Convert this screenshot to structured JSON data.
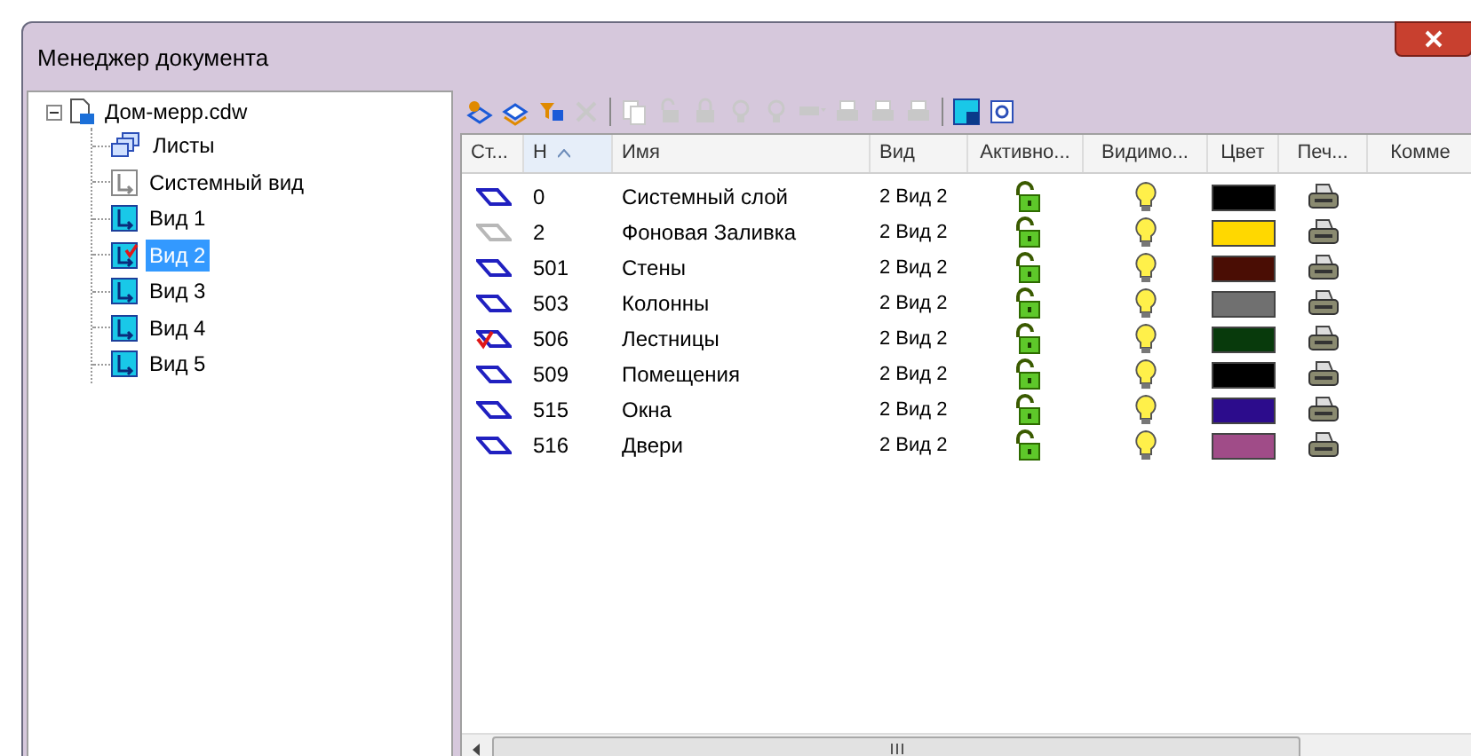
{
  "window": {
    "title": "Менеджер документа"
  },
  "tree": {
    "label": "Дом-мерр.cdw",
    "kind": "file",
    "expanded": true,
    "children": [
      {
        "label": "Листы",
        "kind": "sheets",
        "selected": false,
        "current": false
      },
      {
        "label": "Системный вид",
        "kind": "system-view",
        "selected": false,
        "current": false
      },
      {
        "label": "Вид 1",
        "kind": "view",
        "selected": false,
        "current": false
      },
      {
        "label": "Вид 2",
        "kind": "view",
        "selected": true,
        "current": true
      },
      {
        "label": "Вид 3",
        "kind": "view",
        "selected": false,
        "current": false
      },
      {
        "label": "Вид 4",
        "kind": "view",
        "selected": false,
        "current": false
      },
      {
        "label": "Вид 5",
        "kind": "view",
        "selected": false,
        "current": false
      }
    ]
  },
  "toolbar": [
    {
      "kind": "new-layer",
      "disabled": false
    },
    {
      "kind": "layers",
      "disabled": false
    },
    {
      "kind": "filter",
      "disabled": false
    },
    {
      "kind": "delete",
      "disabled": true
    },
    {
      "kind": "sep"
    },
    {
      "kind": "copy",
      "disabled": true
    },
    {
      "kind": "lock-open",
      "disabled": true
    },
    {
      "kind": "lock",
      "disabled": true
    },
    {
      "kind": "bulb",
      "disabled": true
    },
    {
      "kind": "bulb",
      "disabled": true
    },
    {
      "kind": "color",
      "disabled": true
    },
    {
      "kind": "print",
      "disabled": true
    },
    {
      "kind": "print",
      "disabled": true
    },
    {
      "kind": "print",
      "disabled": true
    },
    {
      "kind": "sep"
    },
    {
      "kind": "view-props",
      "disabled": false
    },
    {
      "kind": "settings",
      "disabled": false
    }
  ],
  "table": {
    "columns": [
      {
        "label": "Ст...",
        "sorted": false
      },
      {
        "label": "Н",
        "sorted": true
      },
      {
        "label": "Имя",
        "sorted": false
      },
      {
        "label": "Вид",
        "sorted": false
      },
      {
        "label": "Активно...",
        "sorted": false
      },
      {
        "label": "Видимо...",
        "sorted": false
      },
      {
        "label": "Цвет",
        "sorted": false
      },
      {
        "label": "Печ...",
        "sorted": false
      },
      {
        "label": "Комме",
        "sorted": false
      }
    ],
    "rows": [
      {
        "kind": "normal",
        "number": "0",
        "name": "Системный слой",
        "view": "2 Вид 2",
        "locked": false,
        "visible": true,
        "color": "#000000",
        "printable": true
      },
      {
        "kind": "background",
        "number": "2",
        "name": "Фоновая Заливка",
        "view": "2 Вид 2",
        "locked": false,
        "visible": true,
        "color": "#ffd800",
        "printable": true
      },
      {
        "kind": "normal",
        "number": "501",
        "name": "Стены",
        "view": "2 Вид 2",
        "locked": false,
        "visible": true,
        "color": "#4a0d04",
        "printable": true
      },
      {
        "kind": "normal",
        "number": "503",
        "name": "Колонны",
        "view": "2 Вид 2",
        "locked": false,
        "visible": true,
        "color": "#707070",
        "printable": true
      },
      {
        "kind": "current",
        "number": "506",
        "name": "Лестницы",
        "view": "2 Вид 2",
        "locked": false,
        "visible": true,
        "color": "#083a0c",
        "printable": true
      },
      {
        "kind": "normal",
        "number": "509",
        "name": "Помещения",
        "view": "2 Вид 2",
        "locked": false,
        "visible": true,
        "color": "#000000",
        "printable": true
      },
      {
        "kind": "normal",
        "number": "515",
        "name": "Окна",
        "view": "2 Вид 2",
        "locked": false,
        "visible": true,
        "color": "#2c0c8c",
        "printable": true
      },
      {
        "kind": "normal",
        "number": "516",
        "name": "Двери",
        "view": "2 Вид 2",
        "locked": false,
        "visible": true,
        "color": "#a04c88",
        "printable": true
      }
    ]
  }
}
